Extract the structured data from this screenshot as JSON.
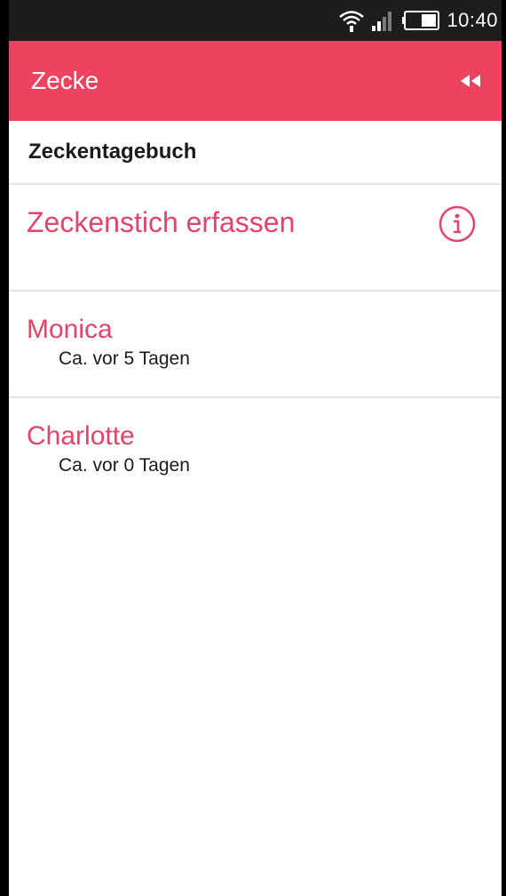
{
  "status_bar": {
    "time": "10:40",
    "icons": [
      "wifi-icon",
      "signal-icon",
      "battery-icon"
    ]
  },
  "app_bar": {
    "title": "Zecke",
    "action_icon": "collapse-icon",
    "color": "#ec4460"
  },
  "section": {
    "title": "Zeckentagebuch"
  },
  "add_entry": {
    "label": "Zeckenstich erfassen",
    "icon": "info-icon"
  },
  "entries": [
    {
      "name": "Monica",
      "subtitle": "Ca. vor 5 Tagen"
    },
    {
      "name": "Charlotte",
      "subtitle": "Ca. vor 0 Tagen"
    }
  ],
  "colors": {
    "accent": "#e2446a",
    "app_bar": "#ec4460",
    "divider": "#e4e4e4"
  }
}
